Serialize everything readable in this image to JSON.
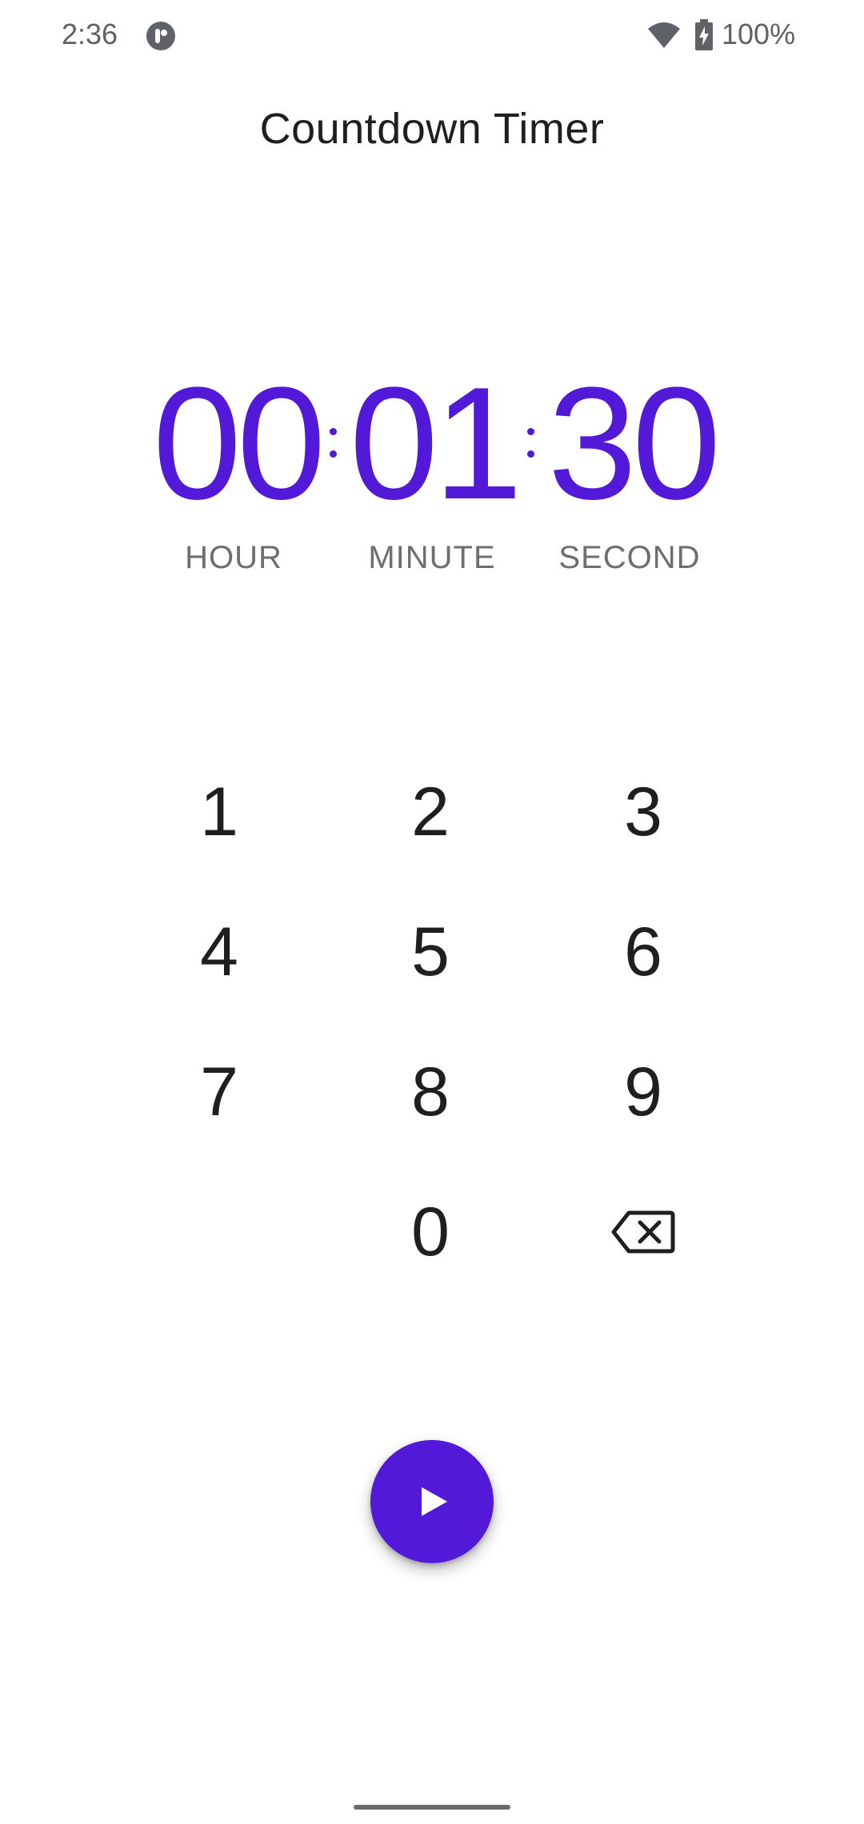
{
  "status_bar": {
    "time": "2:36",
    "battery_percent": "100%",
    "icons": [
      "app-notification-icon",
      "wifi-icon",
      "battery-charging-icon"
    ]
  },
  "app": {
    "title": "Countdown Timer"
  },
  "timer": {
    "hours": "00",
    "minutes": "01",
    "seconds": "30",
    "labels": {
      "hour": "HOUR",
      "minute": "MINUTE",
      "second": "SECOND"
    },
    "accent_color": "#5319d9"
  },
  "keypad": {
    "keys": [
      "1",
      "2",
      "3",
      "4",
      "5",
      "6",
      "7",
      "8",
      "9",
      "0"
    ],
    "backspace_icon": "backspace-icon"
  },
  "fab": {
    "icon": "play-icon",
    "color": "#5319d9"
  }
}
